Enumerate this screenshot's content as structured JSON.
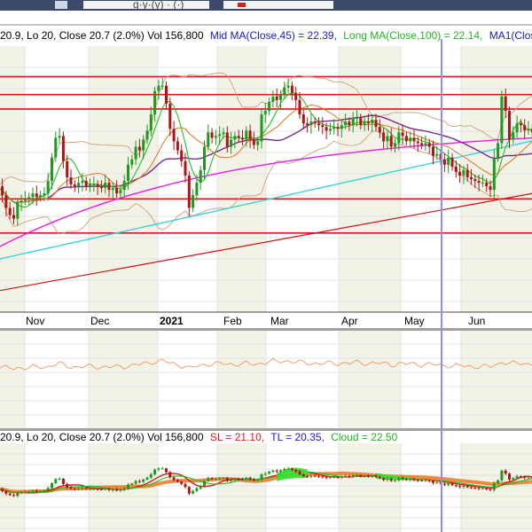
{
  "window": {
    "title_fragment": "g·y·(y) · (·)",
    "titlebar_color": "#3b4a6b"
  },
  "price_panel": {
    "legend": [
      {
        "text": "20.9, Lo 20, Close 20.7 (2.0%) Vol 156,800",
        "color": "#222222"
      },
      {
        "text": "Mid MA(Close,45) = 22.39,",
        "color": "#1a1ad0"
      },
      {
        "text": "Long MA(Close,100) = 22.14,",
        "color": "#22b522"
      },
      {
        "text": "MA1(Close,10",
        "color": "#1a1ad0"
      }
    ]
  },
  "time_axis": {
    "labels": [
      "Nov",
      "Dec",
      "2021",
      "Feb",
      "Mar",
      "Apr",
      "May",
      "Jun"
    ]
  },
  "indicator_panel": {
    "legend": [
      {
        "text": "20.9, Lo 20, Close 20.7 (2.0%) Vol 156,800",
        "color": "#222222"
      },
      {
        "text": "SL = 21.10,",
        "color": "#e01818"
      },
      {
        "text": "TL = 20.35,",
        "color": "#1a1ad0"
      },
      {
        "text": "Cloud = 22.50",
        "color": "#22b522"
      }
    ]
  },
  "colors": {
    "grid": "#e3e3e3",
    "band": "#f2f2e6",
    "up_candle": "#1f9a1f",
    "down_candle": "#b01515",
    "mid_ma": "#7a2a8a",
    "long_ma": "#e61ee6",
    "cyan_ma": "#35d6d6",
    "ma1": "#22c022",
    "slow_ma": "#e08030",
    "bollinger": "#caa27a",
    "hline": "#e01818",
    "trendline": "#d01010",
    "vmarker": "#8e8ef0",
    "panel_sep": "#a0a0a0",
    "cloud_orange": "#f07820",
    "cloud_green": "#34e034"
  },
  "chart_data": {
    "type": "candlestick",
    "horizontal_lines": [
      22.35,
      21.85,
      21.45,
      18.95,
      18.0
    ],
    "trendline": {
      "start": 16.4,
      "end": 19.1
    },
    "x_markers": [
      "May 24"
    ],
    "series": [
      {
        "name": "Mid MA(Close,45)",
        "values": []
      },
      {
        "name": "Long MA(Close,100)",
        "values": []
      },
      {
        "name": "MA1(Close,10",
        "values": []
      }
    ],
    "indicators": {
      "SL": 21.1,
      "TL": 20.35,
      "Cloud": 22.5
    },
    "last_bar": {
      "low": 20,
      "close": 20.7,
      "change_pct": 2.0,
      "volume": 156800
    },
    "closes": [
      19.2,
      19.3,
      19.05,
      18.7,
      18.5,
      18.4,
      18.85,
      18.9,
      18.95,
      19.0,
      19.1,
      19.0,
      19.05,
      19.1,
      19.45,
      20.1,
      20.65,
      20.7,
      20.0,
      19.55,
      19.35,
      19.3,
      19.4,
      19.45,
      19.3,
      19.35,
      19.35,
      19.3,
      19.25,
      19.4,
      19.2,
      19.25,
      19.1,
      19.2,
      19.45,
      19.9,
      20.05,
      20.4,
      20.3,
      20.6,
      20.85,
      21.3,
      21.95,
      22.1,
      22.1,
      21.6,
      20.9,
      20.55,
      20.3,
      20.0,
      19.6,
      18.7,
      19.05,
      19.4,
      19.75,
      20.4,
      20.8,
      20.65,
      20.7,
      20.75,
      20.8,
      20.4,
      20.6,
      20.7,
      20.65,
      20.6,
      20.85,
      20.6,
      20.45,
      20.55,
      21.3,
      21.4,
      21.65,
      21.8,
      21.7,
      21.85,
      22.05,
      22.1,
      21.9,
      21.7,
      21.3,
      21.05,
      21.0,
      21.1,
      21.05,
      21.0,
      20.95,
      20.85,
      20.9,
      20.95,
      20.9,
      21.0,
      21.1,
      21.0,
      21.2,
      21.2,
      21.0,
      21.1,
      21.05,
      21.15,
      20.95,
      20.8,
      20.55,
      20.7,
      20.4,
      20.5,
      20.8,
      20.7,
      20.55,
      20.65,
      20.55,
      20.5,
      20.45,
      20.5,
      20.4,
      20.15,
      20.2,
      20.05,
      19.9,
      20.1,
      19.85,
      19.7,
      19.6,
      19.75,
      19.55,
      19.5,
      19.45,
      19.4,
      19.4,
      19.3,
      19.2,
      20.1,
      20.5,
      21.8,
      21.4,
      20.6,
      20.8,
      21.05,
      21.0,
      20.85,
      20.9,
      20.8,
      20.75,
      20.7
    ]
  }
}
